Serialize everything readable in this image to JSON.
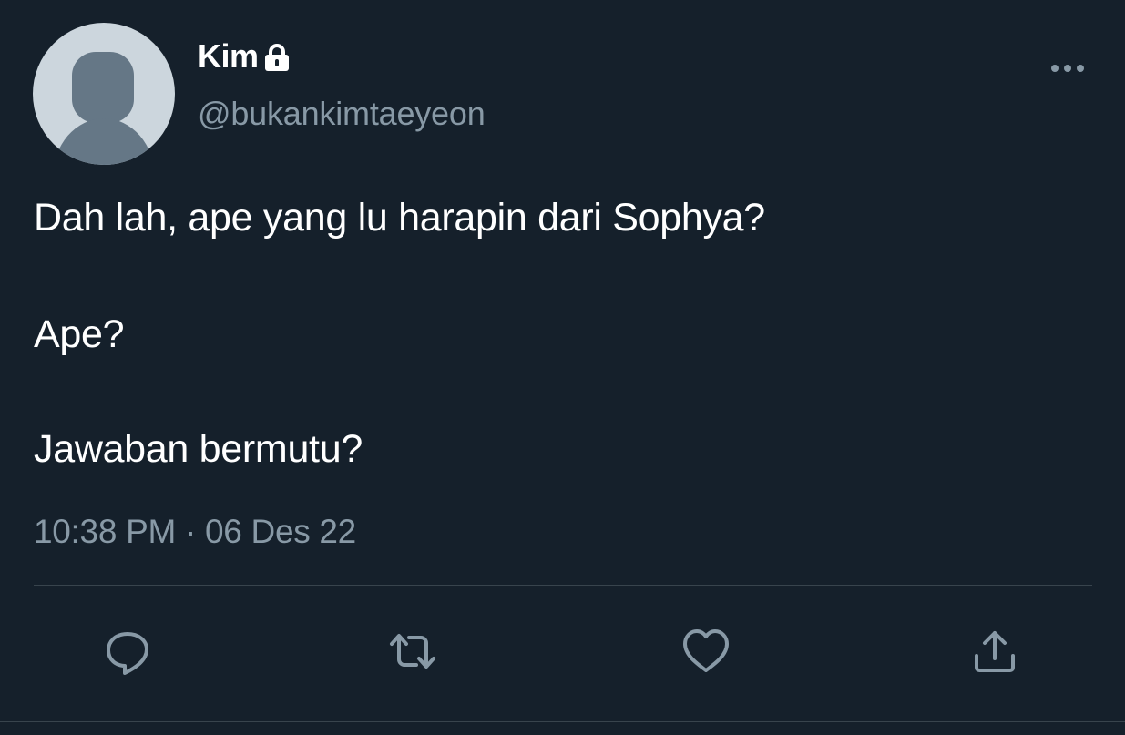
{
  "user": {
    "display_name": "Kim",
    "username": "@bukankimtaeyeon",
    "protected_icon": "lock-icon",
    "avatar": "default-avatar"
  },
  "tweet": {
    "lines": [
      "Dah lah, ape yang lu harapin dari Sophya?",
      "Ape?",
      "Jawaban bermutu?"
    ],
    "time": "10:38 PM",
    "separator": "·",
    "date": "06 Des 22"
  },
  "actions": [
    {
      "name": "reply",
      "icon": "reply-icon"
    },
    {
      "name": "retweet",
      "icon": "retweet-icon"
    },
    {
      "name": "like",
      "icon": "heart-icon"
    },
    {
      "name": "share",
      "icon": "share-icon"
    }
  ],
  "menu": {
    "icon": "more-icon"
  },
  "colors": {
    "background": "#15202b",
    "text": "#ffffff",
    "secondary": "#8899a6",
    "icon": "#8899a6",
    "divider": "#38444d",
    "avatar_bg": "#ccd6dd",
    "avatar_fg": "#657786"
  }
}
